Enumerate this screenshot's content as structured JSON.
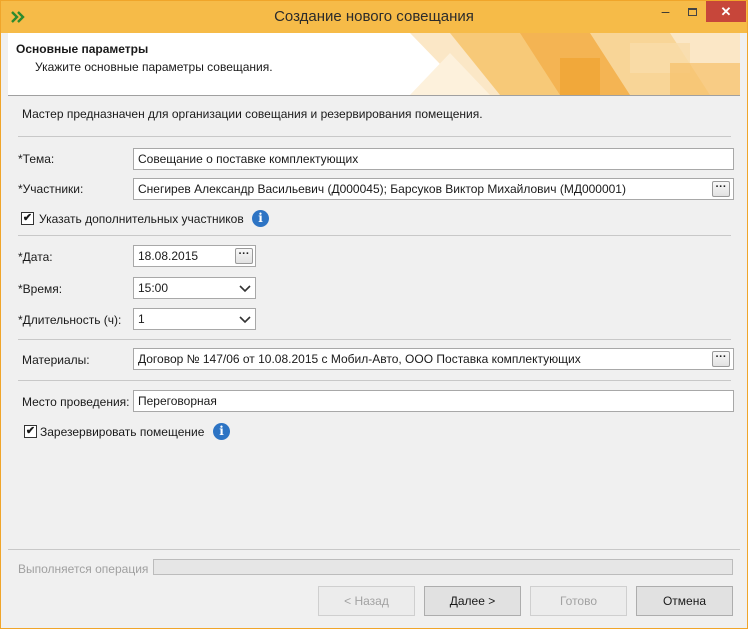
{
  "window": {
    "title": "Создание нового совещания",
    "controls": {
      "minimize": "–",
      "close": "✕"
    }
  },
  "header": {
    "title": "Основные параметры",
    "subtitle": "Укажите основные параметры совещания."
  },
  "description": "Мастер предназначен для организации совещания и резервирования помещения.",
  "form": {
    "topic": {
      "label": "*Тема:",
      "value": "Совещание о поставке комплектующих"
    },
    "participants": {
      "label": "*Участники:",
      "value": "Снегирев Александр Васильевич (Д000045); Барсуков Виктор Михайлович (МД000001)",
      "button": "···"
    },
    "extra_participants": {
      "label": "Указать дополнительных участников",
      "checked": true,
      "mark": "✔"
    },
    "date": {
      "label": "*Дата:",
      "value": "18.08.2015",
      "button": "···"
    },
    "time": {
      "label": "*Время:",
      "value": "15:00"
    },
    "duration": {
      "label": "*Длительность (ч):",
      "value": "1"
    },
    "materials": {
      "label": "Материалы:",
      "value": "Договор № 147/06 от 10.08.2015 с Мобил-Авто, ООО Поставка комплектующих",
      "button": "···"
    },
    "location": {
      "label": "Место проведения:",
      "value": "Переговорная"
    },
    "reserve_room": {
      "label": "Зарезервировать помещение",
      "checked": true,
      "mark": "✔"
    },
    "info_glyph": "i"
  },
  "status": {
    "label": "Выполняется операция",
    "progress": 0
  },
  "buttons": {
    "back": "< Назад",
    "next": "Далее >",
    "finish": "Готово",
    "cancel": "Отмена"
  },
  "colors": {
    "titlebar": "#f6bb48",
    "accent_border": "#f0a52a",
    "close_button": "#c7463a",
    "info_icon": "#2d74c4"
  }
}
